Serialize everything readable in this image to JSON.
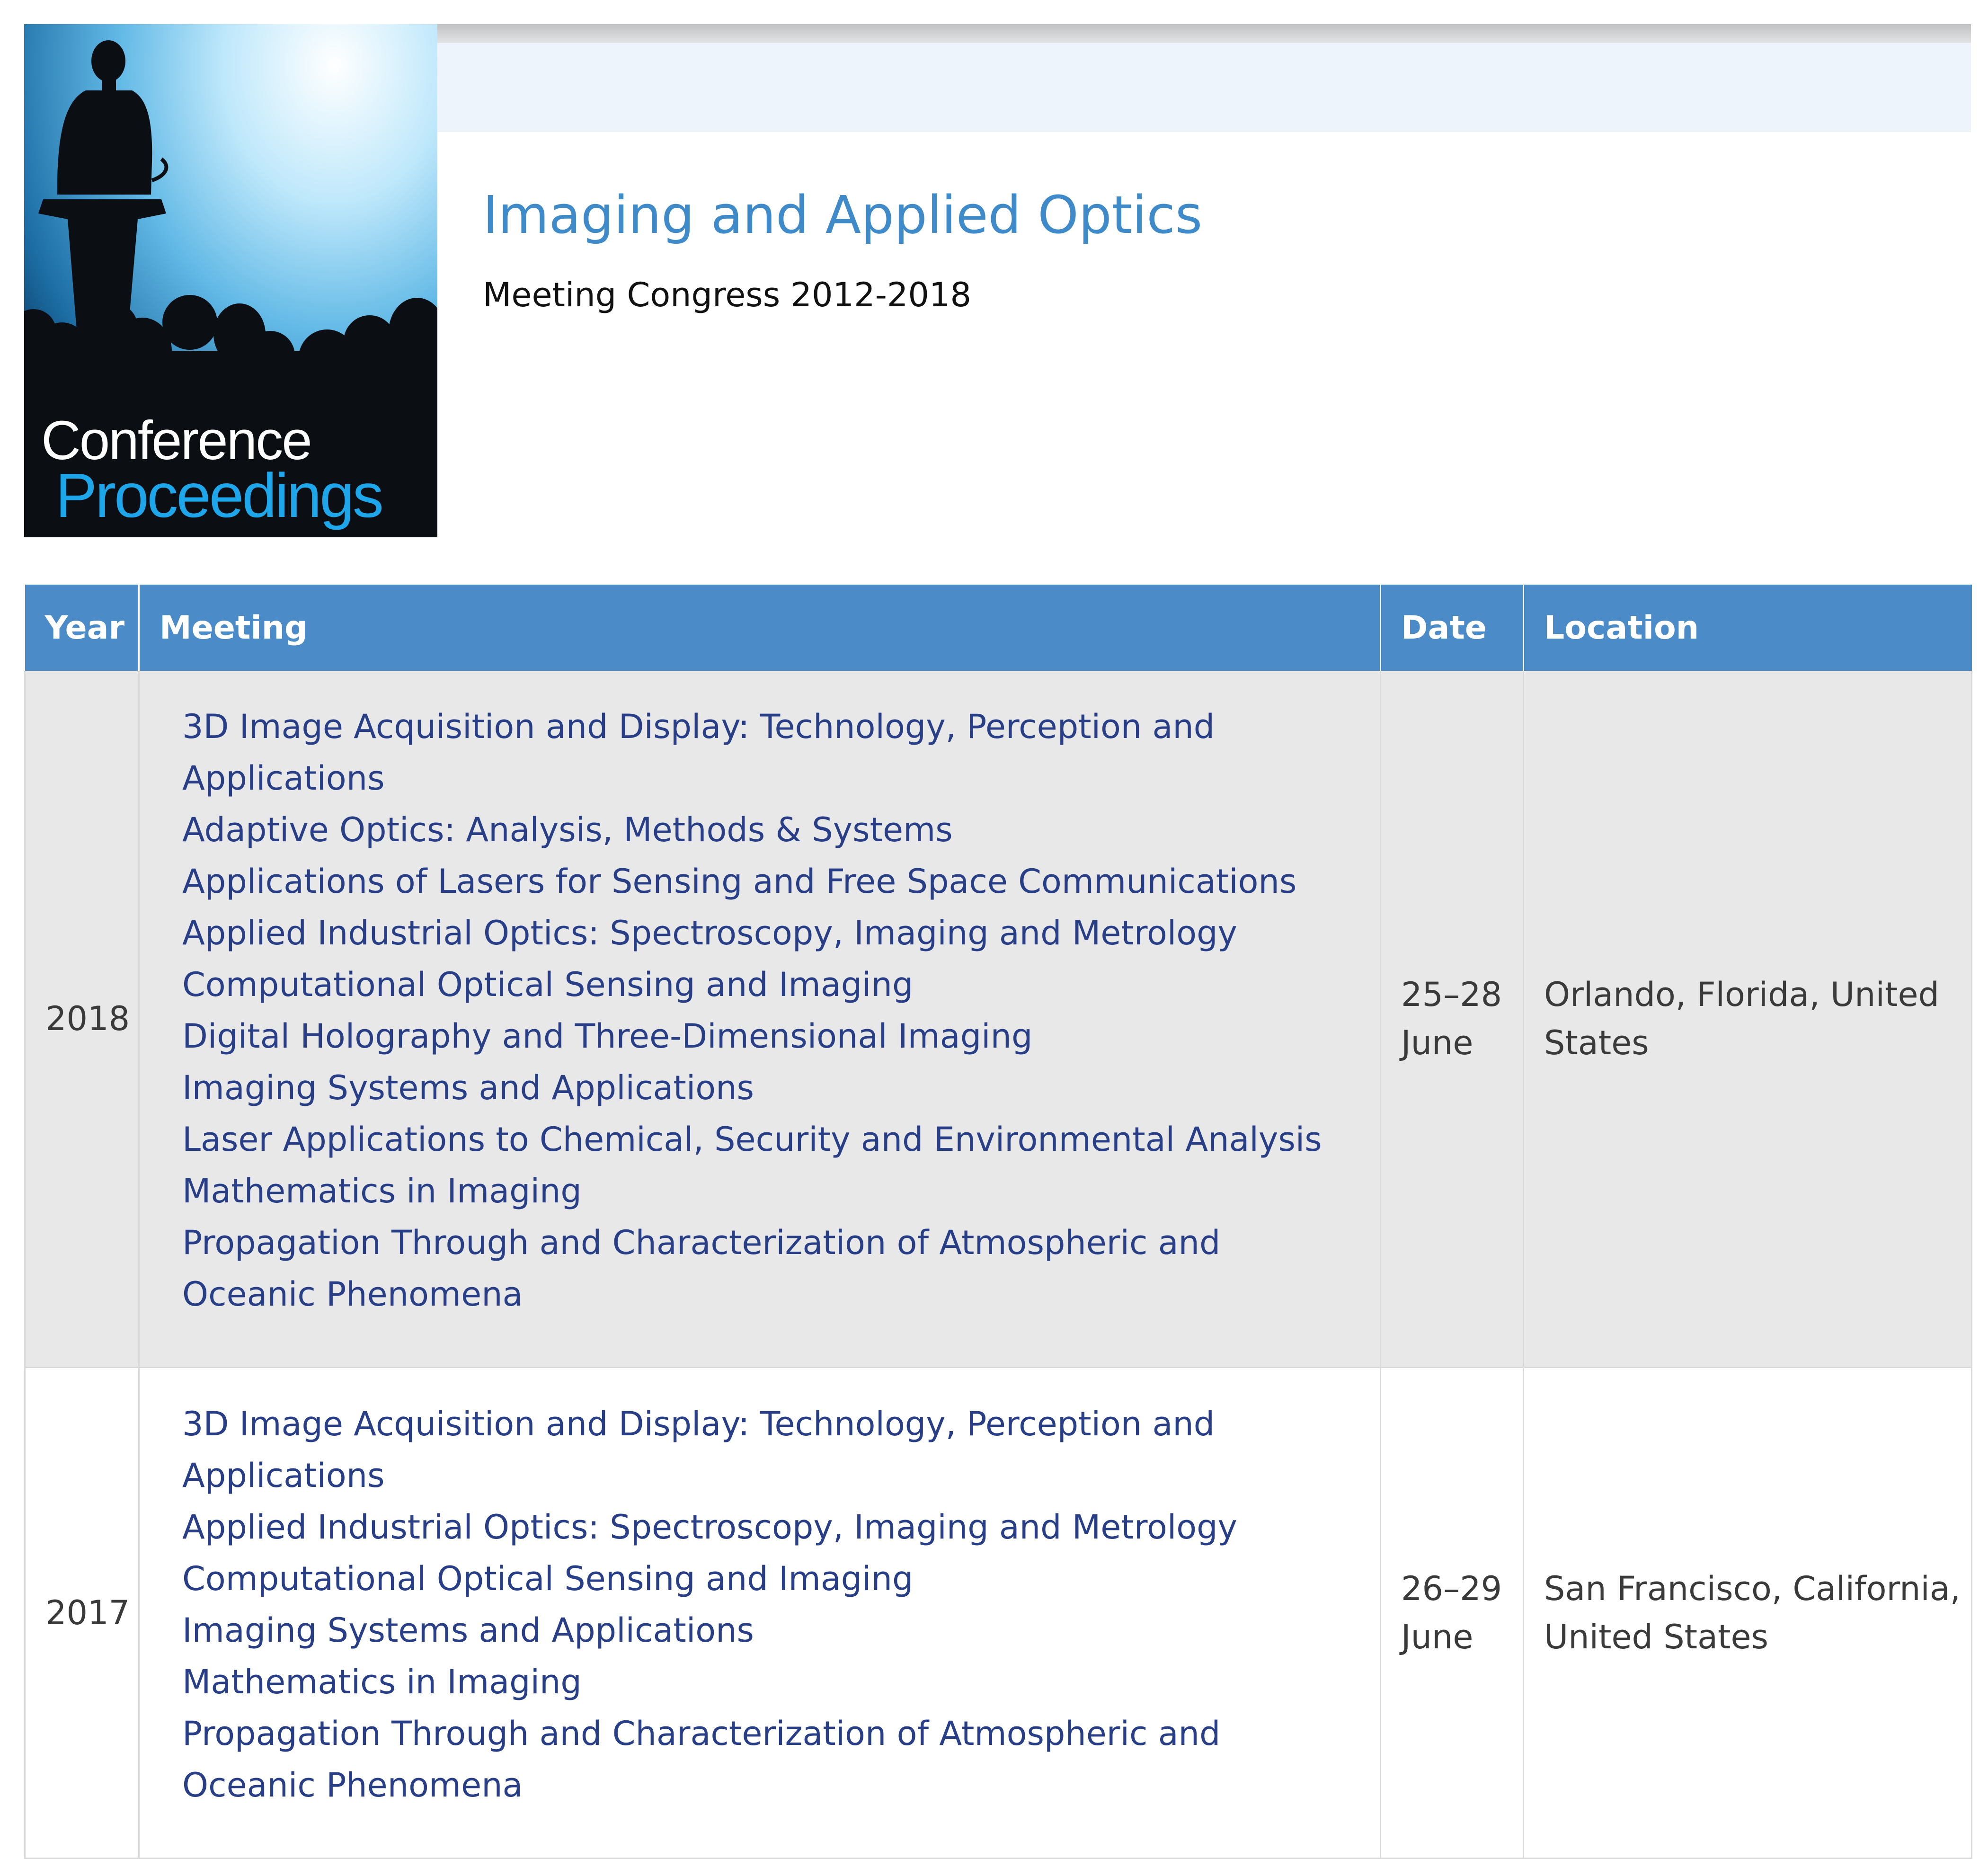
{
  "cover": {
    "word1": "Conference",
    "word2": "Proceedings"
  },
  "header": {
    "title": "Imaging and Applied Optics",
    "subtitle": "Meeting Congress 2012-2018"
  },
  "table": {
    "columns": [
      "Year",
      "Meeting",
      "Date",
      "Location"
    ],
    "rows": [
      {
        "year": "2018",
        "meetings": [
          "3D Image Acquisition and Display: Technology, Perception and Applications",
          "Adaptive Optics: Analysis, Methods & Systems",
          "Applications of Lasers for Sensing and Free Space Communications",
          "Applied Industrial Optics: Spectroscopy, Imaging and Metrology",
          "Computational Optical Sensing and Imaging",
          "Digital Holography and Three-Dimensional Imaging",
          "Imaging Systems and Applications",
          "Laser Applications to Chemical, Security and Environmental Analysis",
          "Mathematics in Imaging",
          "Propagation Through and Characterization of Atmospheric and Oceanic Phenomena"
        ],
        "date": "25–28 June",
        "location": "Orlando, Florida, United States"
      },
      {
        "year": "2017",
        "meetings": [
          "3D Image Acquisition and Display: Technology, Perception and Applications",
          "Applied Industrial Optics: Spectroscopy, Imaging and Metrology",
          "Computational Optical Sensing and Imaging",
          "Imaging Systems and Applications",
          "Mathematics in Imaging",
          "Propagation Through and Characterization of Atmospheric and Oceanic Phenomena"
        ],
        "date": "26–29 June",
        "location": "San Francisco, California, United States"
      }
    ]
  },
  "colors": {
    "title": "#3f8ac8",
    "header_bg": "#4b8bc8",
    "link": "#283f87",
    "row_shade": "#e8e8e8"
  }
}
